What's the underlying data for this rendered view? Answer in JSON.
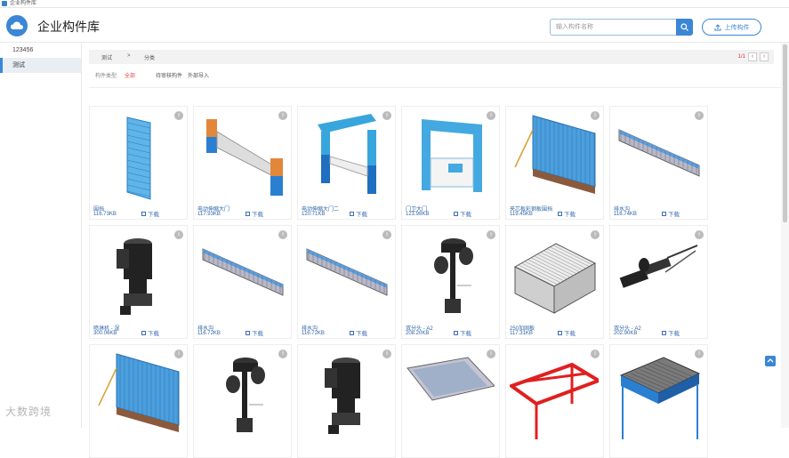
{
  "window": {
    "title": "企业构件库"
  },
  "header": {
    "app_title": "企业构件库",
    "search_placeholder": "输入构件名称",
    "upload_label": "上传构件"
  },
  "sidebar": {
    "items": [
      {
        "label": "123456"
      },
      {
        "label": "测试"
      }
    ]
  },
  "crumbs": {
    "a": "测试",
    "sep": ">",
    "b": "分类"
  },
  "pager": {
    "text": "1/1",
    "prev": "‹",
    "next": "›"
  },
  "filters": {
    "type_label": "构件类型:",
    "type_value": "全部",
    "pending": "待审核构件",
    "import": "外部导入"
  },
  "download_label": "下载",
  "cards": [
    {
      "name": "围挡",
      "size": "116.73KB",
      "icon": "fence-panel-icon"
    },
    {
      "name": "电动伸缩大门",
      "size": "117.93KB",
      "icon": "sliding-gate-icon"
    },
    {
      "name": "电动伸缩大门二",
      "size": "120.71KB",
      "icon": "gate-arch-icon"
    },
    {
      "name": "门卫大门",
      "size": "121.98KB",
      "icon": "gate-house-icon"
    },
    {
      "name": "夹芯板彩钢板围挡",
      "size": "119.45KB",
      "icon": "blue-fence-icon"
    },
    {
      "name": "排水沟",
      "size": "116.74KB",
      "icon": "drain-trench-icon"
    },
    {
      "name": "喷淋机 - 湿",
      "size": "300.06KB",
      "icon": "sprinkler-pump-icon"
    },
    {
      "name": "排水沟",
      "size": "116.72KB",
      "icon": "drain-trench-icon"
    },
    {
      "name": "排水沟",
      "size": "116.72KB",
      "icon": "drain-trench-icon"
    },
    {
      "name": "双分头 - A2",
      "size": "208.20KB",
      "icon": "double-head-icon"
    },
    {
      "name": "250加固板",
      "size": "117.31KB",
      "icon": "plank-stack-icon"
    },
    {
      "name": "双分头 - A2",
      "size": "202.90KB",
      "icon": "wrench-tool-icon"
    },
    {
      "name": "",
      "size": "",
      "icon": "blue-fence-icon"
    },
    {
      "name": "",
      "size": "",
      "icon": "double-head-icon"
    },
    {
      "name": "",
      "size": "",
      "icon": "sprinkler-pump-icon"
    },
    {
      "name": "",
      "size": "",
      "icon": "slab-icon"
    },
    {
      "name": "",
      "size": "",
      "icon": "red-railing-icon"
    },
    {
      "name": "",
      "size": "",
      "icon": "scaffold-icon"
    }
  ],
  "watermark": "大数跨境",
  "colors": {
    "accent": "#3b86d6",
    "link": "#3266a8"
  }
}
